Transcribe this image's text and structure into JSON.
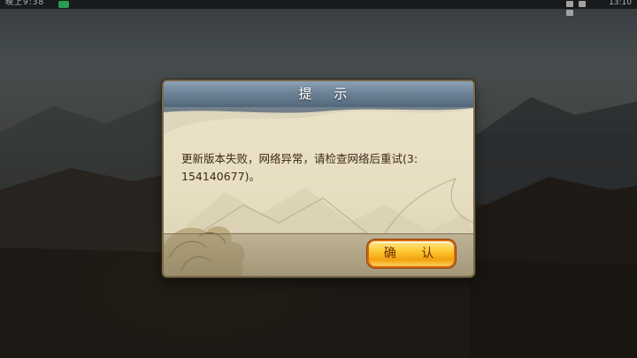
{
  "status_bar": {
    "clock": "晚上9:38",
    "time": "13:10"
  },
  "dialog": {
    "title": "提 示",
    "message_line1": "更新版本失败，网络异常，请检查网络后重试(3:",
    "message_line2": "154140677)。",
    "confirm_label": "确 认"
  },
  "colors": {
    "header_blue": "#6f8398",
    "paper": "#e7ddc1",
    "button_gold": "#ffc934",
    "button_border": "#d96b10"
  },
  "icons": [
    "notification-icon",
    "vibrate-icon",
    "wifi-icon",
    "battery-icon"
  ]
}
